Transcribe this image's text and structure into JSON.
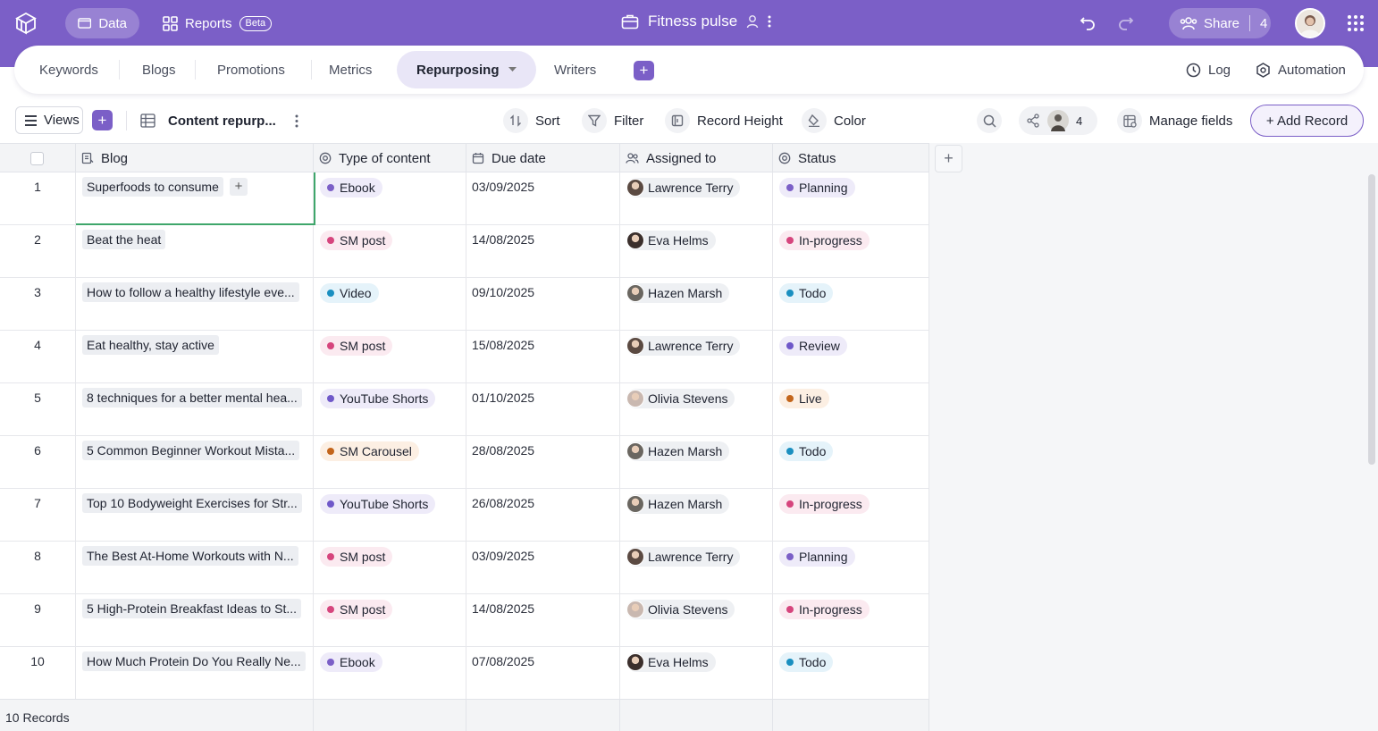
{
  "topbar": {
    "data_label": "Data",
    "reports_label": "Reports",
    "beta_label": "Beta",
    "app_title": "Fitness pulse",
    "share_label": "Share",
    "share_count": "4"
  },
  "tabs": {
    "items": [
      "Keywords",
      "Blogs",
      "Promotions",
      "Metrics",
      "Repurposing",
      "Writers"
    ],
    "active": "Repurposing",
    "log_label": "Log",
    "automation_label": "Automation"
  },
  "toolbar": {
    "views_label": "Views",
    "table_name": "Content repurp...",
    "sort_label": "Sort",
    "filter_label": "Filter",
    "record_height_label": "Record Height",
    "color_label": "Color",
    "collaborator_count": "4",
    "manage_fields_label": "Manage fields",
    "add_record_label": "+ Add Record"
  },
  "columns": {
    "blog": "Blog",
    "type": "Type of content",
    "due": "Due date",
    "assigned": "Assigned to",
    "status": "Status"
  },
  "colors": {
    "accent": "#7b5fc7",
    "ebook": "#7b5fc7",
    "sm_post": "#d6457d",
    "video": "#1a8fc0",
    "youtube_shorts": "#6f58c9",
    "sm_carousel": "#c3651b",
    "planning": "#7b5fc7",
    "in_progress": "#d6457d",
    "todo": "#1a8fc0",
    "review": "#6f58c9",
    "live": "#c3651b"
  },
  "rows": [
    {
      "num": "1",
      "blog": "Superfoods to consume",
      "type": "Ebook",
      "type_color": "#7b5fc7",
      "type_bg": "#eeebf9",
      "due": "03/09/2025",
      "person": "Lawrence Terry",
      "avatar": "#5b4a42",
      "status": "Planning",
      "status_color": "#7b5fc7",
      "status_bg": "#eeebf9"
    },
    {
      "num": "2",
      "blog": "Beat the heat",
      "type": "SM post",
      "type_color": "#d6457d",
      "type_bg": "#fbeaf0",
      "due": "14/08/2025",
      "person": "Eva Helms",
      "avatar": "#3b2f2c",
      "status": "In-progress",
      "status_color": "#d6457d",
      "status_bg": "#fbeaf0"
    },
    {
      "num": "3",
      "blog": "How to follow a healthy lifestyle eve...",
      "type": "Video",
      "type_color": "#1a8fc0",
      "type_bg": "#e5f3fa",
      "due": "09/10/2025",
      "person": "Hazen Marsh",
      "avatar": "#6a6660",
      "status": "Todo",
      "status_color": "#1a8fc0",
      "status_bg": "#e5f3fa"
    },
    {
      "num": "4",
      "blog": "Eat healthy, stay active",
      "type": "SM post",
      "type_color": "#d6457d",
      "type_bg": "#fbeaf0",
      "due": "15/08/2025",
      "person": "Lawrence Terry",
      "avatar": "#5b4a42",
      "status": "Review",
      "status_color": "#6f58c9",
      "status_bg": "#eeebf9"
    },
    {
      "num": "5",
      "blog": "8 techniques for a better mental hea...",
      "type": "YouTube Shorts",
      "type_color": "#6f58c9",
      "type_bg": "#eeebf9",
      "due": "01/10/2025",
      "person": "Olivia Stevens",
      "avatar": "#c9b8b0",
      "status": "Live",
      "status_color": "#c3651b",
      "status_bg": "#fcefe3"
    },
    {
      "num": "6",
      "blog": "5 Common Beginner Workout Mista...",
      "type": "SM Carousel",
      "type_color": "#c3651b",
      "type_bg": "#fcefe3",
      "due": "28/08/2025",
      "person": "Hazen Marsh",
      "avatar": "#6a6660",
      "status": "Todo",
      "status_color": "#1a8fc0",
      "status_bg": "#e5f3fa"
    },
    {
      "num": "7",
      "blog": "Top 10 Bodyweight Exercises for Str...",
      "type": "YouTube Shorts",
      "type_color": "#6f58c9",
      "type_bg": "#eeebf9",
      "due": "26/08/2025",
      "person": "Hazen Marsh",
      "avatar": "#6a6660",
      "status": "In-progress",
      "status_color": "#d6457d",
      "status_bg": "#fbeaf0"
    },
    {
      "num": "8",
      "blog": "The Best At-Home Workouts with N...",
      "type": "SM post",
      "type_color": "#d6457d",
      "type_bg": "#fbeaf0",
      "due": "03/09/2025",
      "person": "Lawrence Terry",
      "avatar": "#5b4a42",
      "status": "Planning",
      "status_color": "#7b5fc7",
      "status_bg": "#eeebf9"
    },
    {
      "num": "9",
      "blog": "5 High-Protein Breakfast Ideas to St...",
      "type": "SM post",
      "type_color": "#d6457d",
      "type_bg": "#fbeaf0",
      "due": "14/08/2025",
      "person": "Olivia Stevens",
      "avatar": "#c9b8b0",
      "status": "In-progress",
      "status_color": "#d6457d",
      "status_bg": "#fbeaf0"
    },
    {
      "num": "10",
      "blog": "How Much Protein Do You Really Ne...",
      "type": "Ebook",
      "type_color": "#7b5fc7",
      "type_bg": "#eeebf9",
      "due": "07/08/2025",
      "person": "Eva Helms",
      "avatar": "#3b2f2c",
      "status": "Todo",
      "status_color": "#1a8fc0",
      "status_bg": "#e5f3fa"
    }
  ],
  "footer": {
    "records_label": "10 Records"
  }
}
